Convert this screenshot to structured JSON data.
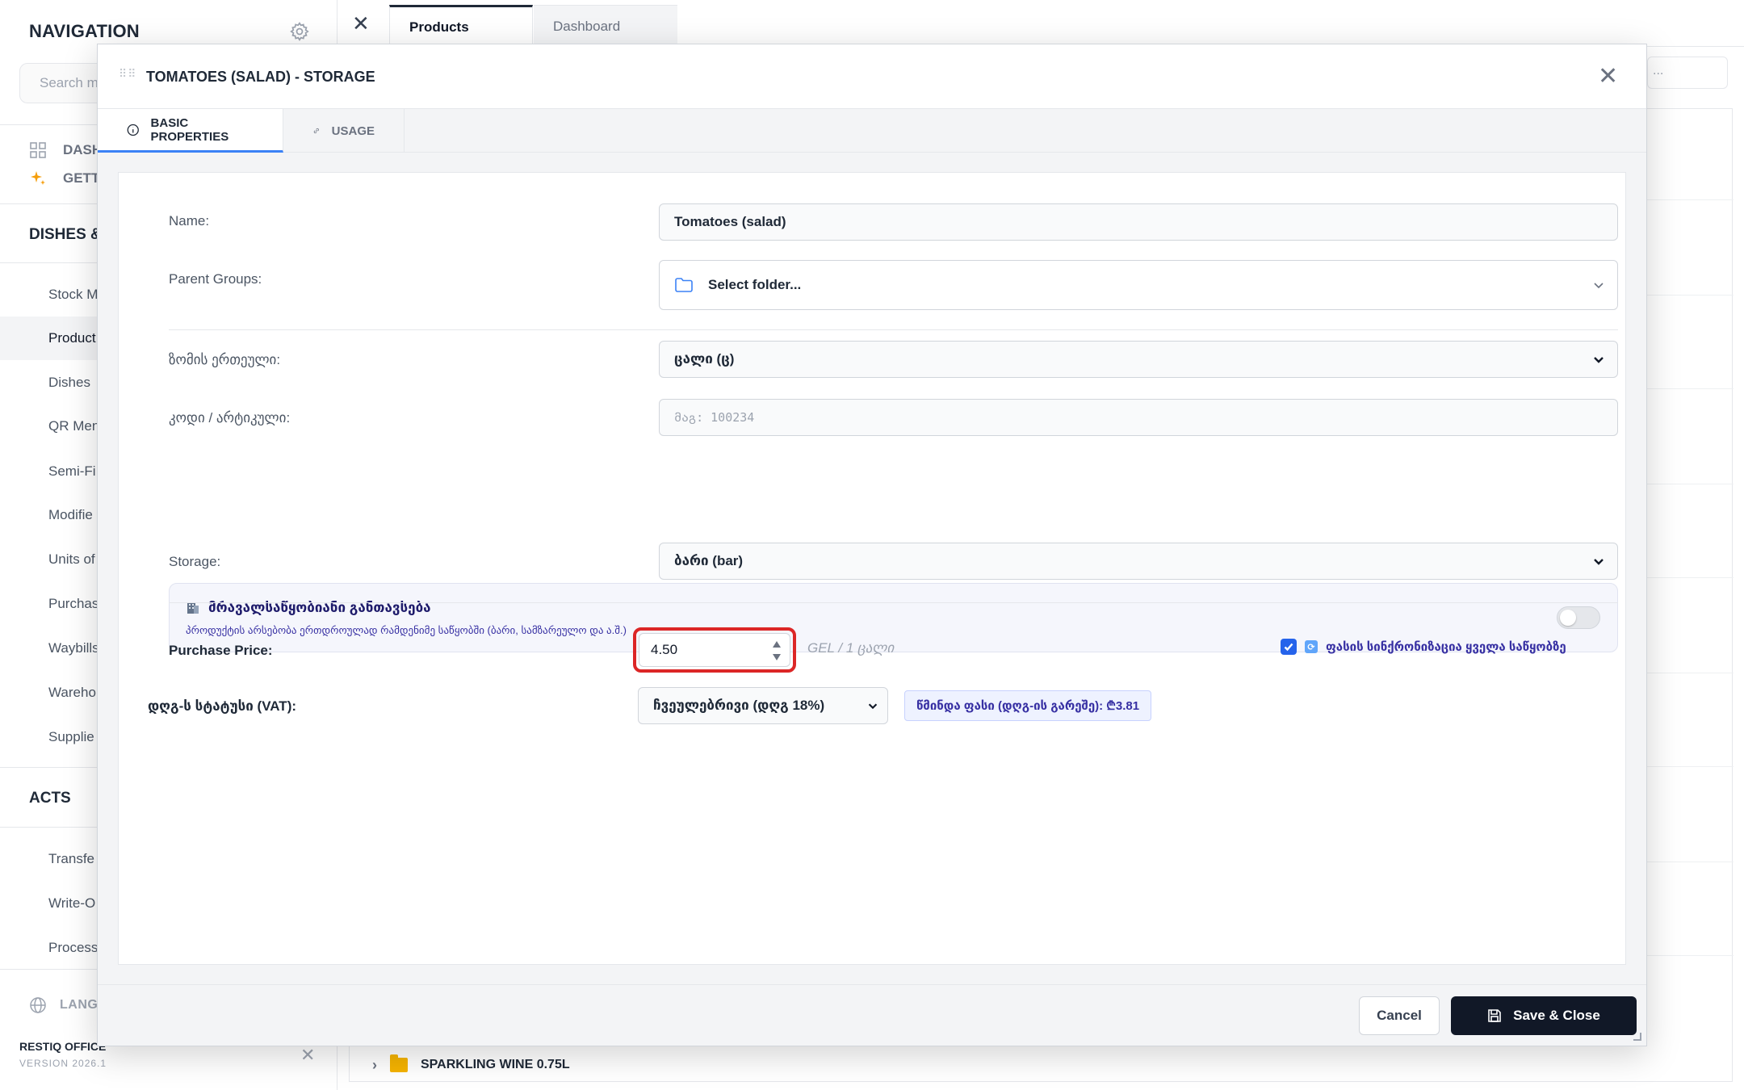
{
  "sidebar": {
    "title": "NAVIGATION",
    "search_placeholder": "Search m",
    "top_links": [
      {
        "label": "DASH",
        "icon": "dashboard-grid-icon"
      },
      {
        "label": "GETTI",
        "icon": "sparkle-icon"
      }
    ],
    "section_dishes": "DISHES &",
    "items": [
      "Stock M",
      "Product",
      "Dishes",
      "QR Men",
      "Semi-Fi",
      "Modifie",
      "Units of",
      "Purchas",
      "Waybills",
      "Wareho",
      "Supplie"
    ],
    "section_acts": "ACTS",
    "acts_items": [
      "Transfe",
      "Write-O",
      "Processi"
    ],
    "language": "LANGU",
    "brand": "RESTIQ OFFICE",
    "version": "VERSION 2026.1"
  },
  "tabs": [
    {
      "label": "Products",
      "active": true
    },
    {
      "label": "Dashboard",
      "active": false
    }
  ],
  "background": {
    "search_placeholder": "...",
    "last_row": "SPARKLING WINE 0.75L"
  },
  "modal": {
    "title": "TOMATOES (SALAD) - STORAGE",
    "tabs": [
      {
        "label": "BASIC PROPERTIES",
        "icon": "info-circle-icon",
        "active": true
      },
      {
        "label": "USAGE",
        "icon": "link-icon",
        "active": false
      }
    ],
    "fields": {
      "name_label": "Name:",
      "name_value": "Tomatoes (salad)",
      "parent_label": "Parent Groups:",
      "parent_value": "Select folder...",
      "unit_label": "ზომის ერთეული:",
      "unit_value": "ცალი (ც)",
      "code_label": "კოდი / არტიკული:",
      "code_placeholder": "მაგ: 100234",
      "multi_title": "მრავალსაწყობიანი განთავსება",
      "multi_sub": "პროდუქტის არსებობა ერთდროულად რამდენიმე საწყობში (ბარი, სამზარეულო და ა.შ.)",
      "storage_label": "Storage:",
      "storage_value": "ბარი (bar)",
      "price_label": "Purchase Price:",
      "price_value": "4.50",
      "price_unit": "GEL / 1 ცალი",
      "sync_label": "ფასის სინქრონიზაცია ყველა საწყობზე",
      "vat_label": "დღგ-ს სტატუსი (VAT):",
      "vat_value": "ჩვეულებრივი (დღგ 18%)",
      "net_price": "წმინდა ფასი (დღგ-ის გარეშე): ₾3.81"
    },
    "footer": {
      "cancel": "Cancel",
      "save": "Save & Close"
    }
  },
  "colors": {
    "accent": "#3b82f6",
    "highlight": "#dc2626",
    "primary_button": "#111827",
    "indigo_text": "#3730a3"
  }
}
